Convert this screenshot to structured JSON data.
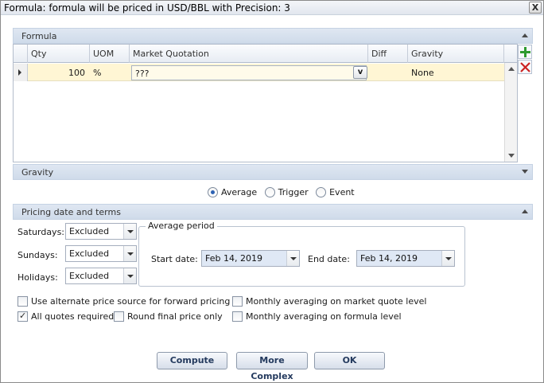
{
  "window": {
    "title": "Formula: formula will be priced in USD/BBL with Precision: 3",
    "close_label": "X"
  },
  "formula_section": {
    "header": "Formula",
    "columns": [
      "Qty",
      "UOM",
      "Market Quotation",
      "Diff",
      "Gravity"
    ],
    "rows": [
      {
        "qty": "100",
        "uom": "%",
        "market_quotation": "???",
        "diff": "",
        "gravity": "None",
        "picker_label": "v"
      }
    ]
  },
  "gravity_section": {
    "header": "Gravity",
    "options": [
      {
        "label": "Average",
        "selected": true
      },
      {
        "label": "Trigger",
        "selected": false
      },
      {
        "label": "Event",
        "selected": false
      }
    ]
  },
  "pricing_section": {
    "header": "Pricing date and terms",
    "saturdays": {
      "label": "Saturdays:",
      "value": "Excluded"
    },
    "sundays": {
      "label": "Sundays:",
      "value": "Excluded"
    },
    "holidays": {
      "label": "Holidays:",
      "value": "Excluded"
    },
    "average_period": {
      "legend": "Average period",
      "start_label": "Start date:",
      "start_value": "Feb 14, 2019",
      "end_label": "End date:",
      "end_value": "Feb 14, 2019"
    },
    "checkboxes": [
      {
        "label": "Use alternate price source for forward pricing",
        "checked": false
      },
      {
        "label": "Monthly averaging on market quote level",
        "checked": false
      },
      {
        "label": "All quotes required",
        "checked": true
      },
      {
        "label": "Round final price only",
        "checked": false
      },
      {
        "label": "Monthly averaging on formula level",
        "checked": false
      }
    ]
  },
  "buttons": {
    "compute": "Compute",
    "more_complex": "More Complex",
    "ok": "OK"
  },
  "colors": {
    "row_highlight": "#fff6d4",
    "section_header": "#d7e1ee",
    "add_icon": "#2e9a2e",
    "delete_icon": "#cc2222"
  }
}
